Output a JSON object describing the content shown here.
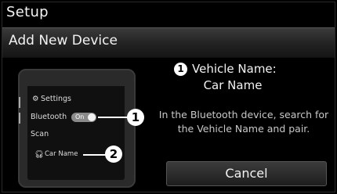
{
  "header": {
    "title": "Setup"
  },
  "subheader": {
    "title": "Add New Device"
  },
  "phone": {
    "menu": {
      "settings": "Settings",
      "bluetooth": "Bluetooth",
      "bluetooth_toggle": "On",
      "scan": "Scan",
      "device": "Car Name"
    }
  },
  "callouts": {
    "one": "1",
    "two": "2"
  },
  "info": {
    "badge": "1",
    "vehicle_name_label": "Vehicle Name:",
    "vehicle_name_value": "Car Name",
    "instruction": "In the Bluetooth device, search for the Vehicle Name and pair."
  },
  "actions": {
    "cancel_label": "Cancel"
  }
}
